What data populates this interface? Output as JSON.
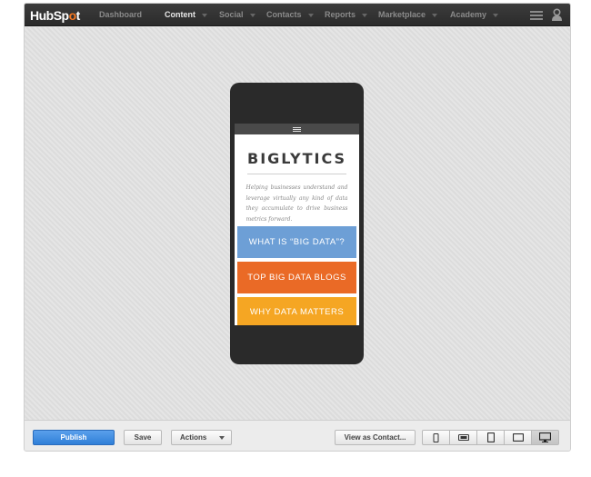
{
  "brand": {
    "logo_text_a": "HubSp",
    "logo_text_b": "o",
    "logo_text_c": "t",
    "accent": "#f57722"
  },
  "nav": {
    "items": [
      {
        "label": "Dashboard"
      },
      {
        "label": "Content"
      },
      {
        "label": "Social"
      },
      {
        "label": "Contacts"
      },
      {
        "label": "Reports"
      },
      {
        "label": "Marketplace"
      },
      {
        "label": "Academy"
      }
    ],
    "active_item": "Content",
    "right_icons": [
      "menu-icon",
      "user-icon"
    ]
  },
  "preview": {
    "device": "phone",
    "site_logo": "BIGLYTICS",
    "tagline": "Helping businesses understand and leverage virtually any kind of data they accumulate to drive business metrics forward.",
    "buttons": [
      {
        "label": "WHAT IS “BIG DATA”?",
        "color": "#6d9fd6"
      },
      {
        "label": "TOP BIG DATA BLOGS",
        "color": "#ea6a26"
      },
      {
        "label": "WHY DATA MATTERS",
        "color": "#f5a623"
      }
    ]
  },
  "toolbar": {
    "publish_label": "Publish",
    "save_label": "Save",
    "actions_label": "Actions",
    "view_as_label": "View as Contact...",
    "devices": [
      "phone-portrait-icon",
      "phone-landscape-icon",
      "tablet-portrait-icon",
      "tablet-landscape-icon",
      "desktop-icon"
    ],
    "active_device": "desktop-icon",
    "publish_color": "#2f7fd8"
  }
}
